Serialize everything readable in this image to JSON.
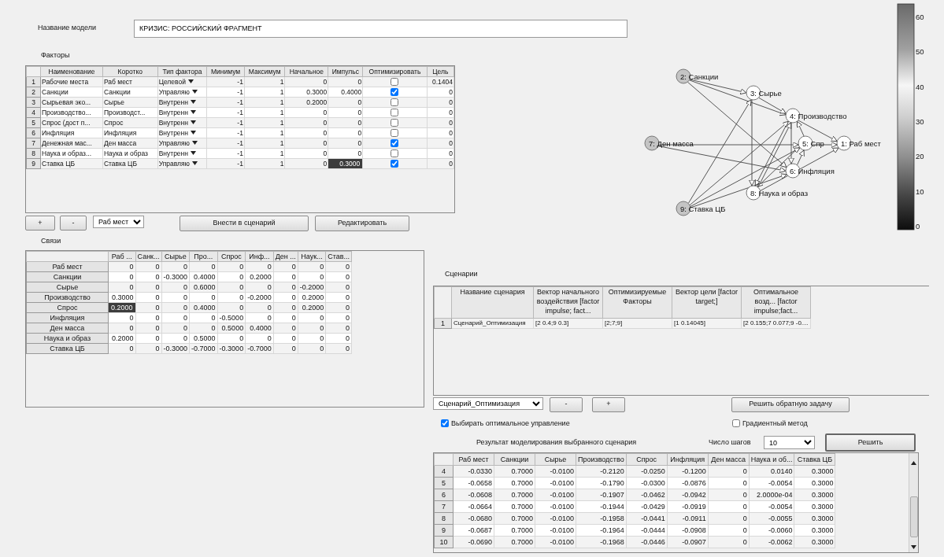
{
  "model_name": {
    "label": "Название модели",
    "value": "КРИЗИС: РОССИЙСКИЙ ФРАГМЕНТ"
  },
  "factors": {
    "title": "Факторы",
    "columns": [
      "Наименование",
      "Коротко",
      "Тип фактора",
      "Минимум",
      "Максимум",
      "Начальное",
      "Импульс",
      "Оптимизировать",
      "Цель"
    ],
    "rows": [
      {
        "number": "1",
        "name": "Рабочие места",
        "short": "Раб мест",
        "type": "Целевой",
        "min": "-1",
        "max": "1",
        "initial": "0",
        "impulse": "0",
        "impulse_selected": false,
        "optimize": false,
        "target": "0.1404"
      },
      {
        "number": "2",
        "name": "Санкции",
        "short": "Санкции",
        "type": "Управляю",
        "min": "-1",
        "max": "1",
        "initial": "0.3000",
        "impulse": "0.4000",
        "impulse_selected": false,
        "optimize": true,
        "target": "0"
      },
      {
        "number": "3",
        "name": "Сырьевая эко...",
        "short": "Сырье",
        "type": "Внутренн",
        "min": "-1",
        "max": "1",
        "initial": "0.2000",
        "impulse": "0",
        "impulse_selected": false,
        "optimize": false,
        "target": "0"
      },
      {
        "number": "4",
        "name": "Производство...",
        "short": "Производст...",
        "type": "Внутренн",
        "min": "-1",
        "max": "1",
        "initial": "0",
        "impulse": "0",
        "impulse_selected": false,
        "optimize": false,
        "target": "0"
      },
      {
        "number": "5",
        "name": "Спрос (дост п...",
        "short": "Спрос",
        "type": "Внутренн",
        "min": "-1",
        "max": "1",
        "initial": "0",
        "impulse": "0",
        "impulse_selected": false,
        "optimize": false,
        "target": "0"
      },
      {
        "number": "6",
        "name": "Инфляция",
        "short": "Инфляция",
        "type": "Внутренн",
        "min": "-1",
        "max": "1",
        "initial": "0",
        "impulse": "0",
        "impulse_selected": false,
        "optimize": false,
        "target": "0"
      },
      {
        "number": "7",
        "name": "Денежная мас...",
        "short": "Ден масса",
        "type": "Управляю",
        "min": "-1",
        "max": "1",
        "initial": "0",
        "impulse": "0",
        "impulse_selected": false,
        "optimize": true,
        "target": "0"
      },
      {
        "number": "8",
        "name": "Наука и образ...",
        "short": "Наука и образ",
        "type": "Внутренн",
        "min": "-1",
        "max": "1",
        "initial": "0",
        "impulse": "0",
        "impulse_selected": false,
        "optimize": false,
        "target": "0"
      },
      {
        "number": "9",
        "name": "Ставка ЦБ",
        "short": "Ставка ЦБ",
        "type": "Управляю",
        "min": "-1",
        "max": "1",
        "initial": "0",
        "impulse": "0.3000",
        "impulse_selected": true,
        "optimize": true,
        "target": "0"
      }
    ]
  },
  "factor_controls": {
    "add": "+",
    "remove": "-",
    "factor_select": "Раб мест",
    "to_scenario": "Внести в сценарий",
    "edit": "Редактировать"
  },
  "links": {
    "title": "Связи",
    "columns": [
      "Раб ...",
      "Санк...",
      "Сырье",
      "Про...",
      "Спрос",
      "Инф...",
      "Ден ...",
      "Наук...",
      "Став..."
    ],
    "rows": [
      {
        "label": "Раб мест",
        "values": [
          "0",
          "0",
          "0",
          "0",
          "0",
          "0",
          "0",
          "0",
          "0"
        ]
      },
      {
        "label": "Санкции",
        "values": [
          "0",
          "0",
          "-0.3000",
          "0.4000",
          "0",
          "0.2000",
          "0",
          "0",
          "0"
        ]
      },
      {
        "label": "Сырье",
        "values": [
          "0",
          "0",
          "0",
          "0.6000",
          "0",
          "0",
          "0",
          "-0.2000",
          "0"
        ]
      },
      {
        "label": "Производство",
        "values": [
          "0.3000",
          "0",
          "0",
          "0",
          "0",
          "-0.2000",
          "0",
          "0.2000",
          "0"
        ]
      },
      {
        "label": "Спрос",
        "values": [
          {
            "text": "0.2000",
            "selected": true
          },
          "0",
          "0",
          "0.4000",
          "0",
          "0",
          "0",
          "0.2000",
          "0"
        ]
      },
      {
        "label": "Инфляция",
        "values": [
          "0",
          "0",
          "0",
          "0",
          "-0.5000",
          "0",
          "0",
          "0",
          "0"
        ]
      },
      {
        "label": "Ден масса",
        "values": [
          "0",
          "0",
          "0",
          "0",
          "0.5000",
          "0.4000",
          "0",
          "0",
          "0"
        ]
      },
      {
        "label": "Наука и образ",
        "values": [
          "0.2000",
          "0",
          "0",
          "0.5000",
          "0",
          "0",
          "0",
          "0",
          "0"
        ]
      },
      {
        "label": "Ставка ЦБ",
        "values": [
          "0",
          "0",
          "-0.3000",
          "-0.7000",
          "-0.3000",
          "-0.7000",
          "0",
          "0",
          "0"
        ]
      }
    ]
  },
  "graph": {
    "nodes": [
      {
        "label": "1: Раб мест",
        "color": "#ffffff"
      },
      {
        "label": "2: Санкции",
        "color": "#c4c4c4"
      },
      {
        "label": "3: Сырье",
        "color": "#ffffff"
      },
      {
        "label": "4: Производство",
        "color": "#ffffff"
      },
      {
        "label": "5: Спр",
        "color": "#ffffff"
      },
      {
        "label": "6: Инфляция",
        "color": "#ffffff"
      },
      {
        "label": "7: Ден масса",
        "color": "#c4c4c4"
      },
      {
        "label": "8: Наука и образ",
        "color": "#ffffff"
      },
      {
        "label": "9: Ставка ЦБ",
        "color": "#c4c4c4"
      }
    ]
  },
  "colorbar": {
    "ticks": [
      "60",
      "50",
      "40",
      "30",
      "20",
      "10",
      "0"
    ]
  },
  "scenarios": {
    "title": "Сценарии",
    "columns": [
      "Название сценария",
      "Вектор начального воздействия [factor impulse; fact...",
      "Оптимизируемые Факторы",
      "Вектор цели [factor target;]",
      "Оптимальное возд... [factor impulse;fact..."
    ],
    "rows": [
      {
        "number": "1",
        "cells": [
          "Сценарий_Оптимизация",
          "[2 0.4;9 0.3]",
          "[2;7;9]",
          "[1 0.14045]",
          "[2 0.155;7 0.077;9 -0...."
        ]
      }
    ]
  },
  "scenario_controls": {
    "select": "Сценарий_Оптимизация",
    "remove": "-",
    "add": "+",
    "solve_inverse": "Решить обратную задачу"
  },
  "options": [
    {
      "label": "Выбирать оптимальное управление",
      "checked": true
    },
    {
      "label": "Градиентный метод",
      "checked": false
    }
  ],
  "results": {
    "title": "Результат моделирования выбранного сценария",
    "steps_label": "Число шагов",
    "steps": "10",
    "solve": "Решить",
    "columns": [
      "Раб мест",
      "Санкции",
      "Сырье",
      "Производство",
      "Спрос",
      "Инфляция",
      "Ден масса",
      "Наука и об...",
      "Ставка ЦБ"
    ],
    "rows": [
      {
        "number": "4",
        "values": [
          "-0.0330",
          "0.7000",
          "-0.0100",
          "-0.2120",
          "-0.0250",
          "-0.1200",
          "0",
          "0.0140",
          "0.3000"
        ]
      },
      {
        "number": "5",
        "values": [
          "-0.0658",
          "0.7000",
          "-0.0100",
          "-0.1790",
          "-0.0300",
          "-0.0876",
          "0",
          "-0.0054",
          "0.3000"
        ]
      },
      {
        "number": "6",
        "values": [
          "-0.0608",
          "0.7000",
          "-0.0100",
          "-0.1907",
          "-0.0462",
          "-0.0942",
          "0",
          "2.0000e-04",
          "0.3000"
        ]
      },
      {
        "number": "7",
        "values": [
          "-0.0664",
          "0.7000",
          "-0.0100",
          "-0.1944",
          "-0.0429",
          "-0.0919",
          "0",
          "-0.0054",
          "0.3000"
        ]
      },
      {
        "number": "8",
        "values": [
          "-0.0680",
          "0.7000",
          "-0.0100",
          "-0.1958",
          "-0.0441",
          "-0.0911",
          "0",
          "-0.0055",
          "0.3000"
        ]
      },
      {
        "number": "9",
        "values": [
          "-0.0687",
          "0.7000",
          "-0.0100",
          "-0.1964",
          "-0.0444",
          "-0.0908",
          "0",
          "-0.0060",
          "0.3000"
        ]
      },
      {
        "number": "10",
        "values": [
          "-0.0690",
          "0.7000",
          "-0.0100",
          "-0.1968",
          "-0.0446",
          "-0.0907",
          "0",
          "-0.0062",
          "0.3000"
        ]
      }
    ]
  }
}
